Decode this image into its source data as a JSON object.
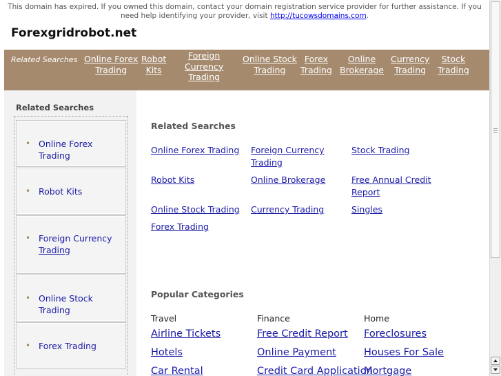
{
  "notice": {
    "text": "This domain has expired. If you owned this domain, contact your domain registration service provider for further assistance. If you need help identifying your provider, visit",
    "link": "http://tucowsdomains.com",
    "end": "."
  },
  "site_title": "Forexgridrobot.net",
  "nav": {
    "label": "Related Searches",
    "items": [
      {
        "line1": "Online Forex",
        "line2": "Trading",
        "line3": ""
      },
      {
        "line1": "Robot",
        "line2": "Kits",
        "line3": ""
      },
      {
        "line1": "Foreign",
        "line2": "Currency",
        "line3": "Trading"
      },
      {
        "line1": "Online Stock",
        "line2": "Trading",
        "line3": ""
      },
      {
        "line1": "Forex",
        "line2": "Trading",
        "line3": ""
      },
      {
        "line1": "Online",
        "line2": "Brokerage",
        "line3": ""
      },
      {
        "line1": "Currency",
        "line2": "Trading",
        "line3": ""
      },
      {
        "line1": "Stock",
        "line2": "Trading",
        "line3": ""
      }
    ]
  },
  "sidebar": {
    "title": "Related Searches",
    "bullet": "•",
    "items": [
      {
        "line1": "Online Forex Trading",
        "line2": ""
      },
      {
        "line1": "Robot Kits",
        "line2": ""
      },
      {
        "line1": "Foreign Currency",
        "line2": "Trading"
      },
      {
        "line1": "Online Stock Trading",
        "line2": ""
      },
      {
        "line1": "Forex Trading",
        "line2": ""
      }
    ]
  },
  "main": {
    "related_title": "Related Searches",
    "related": [
      {
        "line1": "Online Forex Trading",
        "line2": ""
      },
      {
        "line1": "Foreign Currency",
        "line2": "Trading"
      },
      {
        "line1": "Stock Trading",
        "line2": ""
      },
      {
        "line1": "Robot Kits",
        "line2": ""
      },
      {
        "line1": "Online Brokerage",
        "line2": ""
      },
      {
        "line1": "Free Annual Credit",
        "line2": "Report"
      },
      {
        "line1": "Online Stock Trading",
        "line2": ""
      },
      {
        "line1": "Currency Trading",
        "line2": ""
      },
      {
        "line1": "Singles",
        "line2": ""
      },
      {
        "line1": "Forex Trading",
        "line2": ""
      }
    ],
    "popular_title": "Popular Categories",
    "categories": [
      {
        "heading": "Travel",
        "links": [
          "Airline Tickets",
          "Hotels",
          "Car Rental"
        ]
      },
      {
        "heading": "Finance",
        "links": [
          "Free Credit Report",
          "Online Payment",
          "Credit Card Application"
        ]
      },
      {
        "heading": "Home",
        "links": [
          "Foreclosures",
          "Houses For Sale",
          "Mortgage"
        ]
      }
    ]
  },
  "colors": {
    "nav_bg": "#a58a6e",
    "link": "#1a1aa6",
    "sidebar_bg": "#f2f2f2"
  }
}
